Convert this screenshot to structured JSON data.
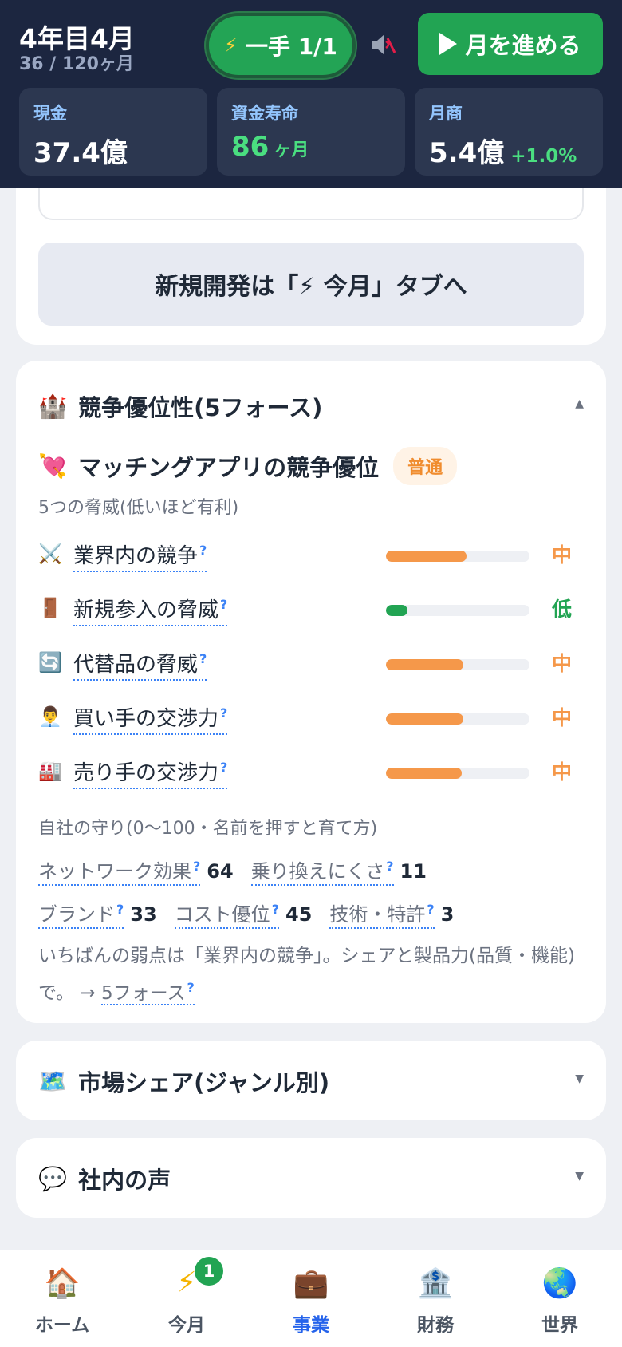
{
  "header": {
    "title": "4年目4月",
    "progress": "36 / 120ヶ月",
    "action_label": "一手 1/1",
    "advance_label": "月を進める",
    "stats": {
      "cash": {
        "label": "現金",
        "value": "37.4億"
      },
      "runway": {
        "label": "資金寿命",
        "value": "86",
        "unit": "ヶ月"
      },
      "monthly": {
        "label": "月商",
        "value": "5.4億",
        "delta": "+1.0%"
      }
    }
  },
  "dev_card": {
    "new_dev_label": "新規開発は「⚡ 今月」タブへ"
  },
  "competitive": {
    "section_title": "競争優位性(5フォース)",
    "app_title": "マッチングアプリの競争優位",
    "badge": "普通",
    "threats_label": "5つの脅威(低いほど有利)",
    "forces": [
      {
        "icon": "⚔️",
        "name": "業界内の競争",
        "level": "中",
        "value": 0.56
      },
      {
        "icon": "🚪",
        "name": "新規参入の脅威",
        "level": "低",
        "value": 0.15
      },
      {
        "icon": "🔄",
        "name": "代替品の脅威",
        "level": "中",
        "value": 0.54
      },
      {
        "icon": "👨‍💼",
        "name": "買い手の交渉力",
        "level": "中",
        "value": 0.54
      },
      {
        "icon": "🏭",
        "name": "売り手の交渉力",
        "level": "中",
        "value": 0.53
      }
    ],
    "defense_label": "自社の守り(0〜100・名前を押すと育て方)",
    "defense_row1": [
      {
        "name": "ネットワーク効果",
        "value": "64"
      },
      {
        "name": "乗り換えにくさ",
        "value": "11"
      }
    ],
    "defense_row2": [
      {
        "name": "ブランド",
        "value": "33"
      },
      {
        "name": "コスト優位",
        "value": "45"
      },
      {
        "name": "技術・特許",
        "value": "3"
      }
    ],
    "weakness_text": "いちばんの弱点は「業界内の競争」。シェアと製品力(品質・機能)で。 →",
    "weakness_link": "5フォース"
  },
  "market_share": {
    "title": "市場シェア(ジャンル別)"
  },
  "voices": {
    "title": "社内の声"
  },
  "bottom_nav": {
    "home": "ホーム",
    "month": "今月",
    "month_badge": "1",
    "business": "事業",
    "finance": "財務",
    "world": "世界"
  },
  "colors": {
    "orange": "#f5984a",
    "green": "#22a453",
    "accent_blue": "#2563eb"
  }
}
